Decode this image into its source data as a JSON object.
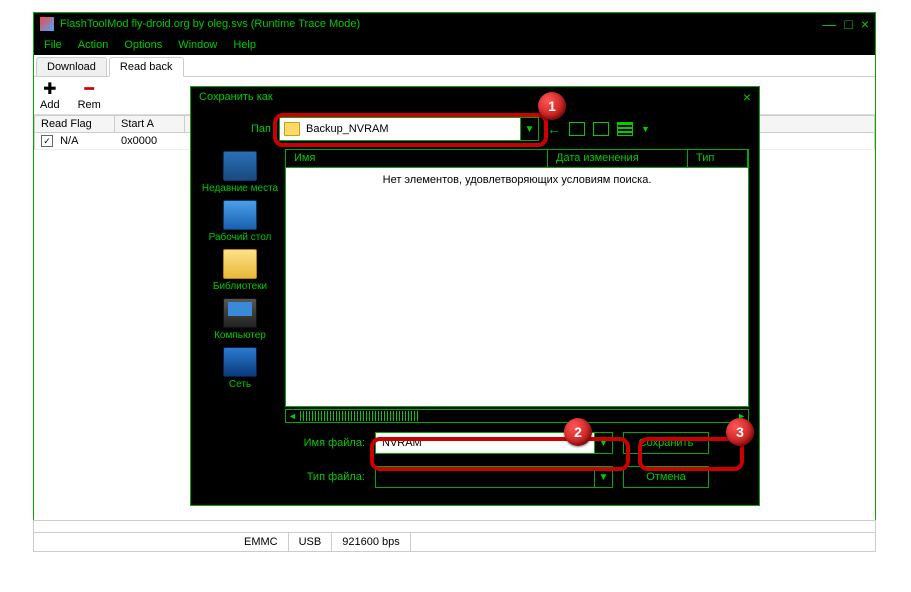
{
  "app": {
    "title": "FlashToolMod fly-droid.org by oleg.svs (Runtime Trace Mode)",
    "menus": [
      "File",
      "Action",
      "Options",
      "Window",
      "Help"
    ]
  },
  "tabs": {
    "download": "Download",
    "readback": "Read back"
  },
  "toolbar": {
    "add": "Add",
    "remove": "Rem"
  },
  "table": {
    "headers": {
      "flag": "Read Flag",
      "start": "Start A"
    },
    "rows": [
      {
        "flag": "N/A",
        "start": "0x0000"
      }
    ]
  },
  "dialog": {
    "title": "Сохранить как",
    "folder_label": "Пап",
    "folder_value": "Backup_NVRAM",
    "sidebar": {
      "recent": "Недавние места",
      "desktop": "Рабочий стол",
      "libraries": "Библиотеки",
      "computer": "Компьютер",
      "network": "Сеть"
    },
    "file_headers": {
      "name": "Имя",
      "date": "Дата изменения",
      "type": "Тип"
    },
    "empty_text": "Нет элементов, удовлетворяющих условиям поиска.",
    "filename_label": "Имя файла:",
    "filename_value": "NVRAM",
    "filetype_label": "Тип файла:",
    "save_btn": "Сохранить",
    "cancel_btn": "Отмена"
  },
  "status": {
    "storage": "EMMC",
    "conn": "USB",
    "baud": "921600 bps"
  },
  "badges": {
    "b1": "1",
    "b2": "2",
    "b3": "3"
  }
}
